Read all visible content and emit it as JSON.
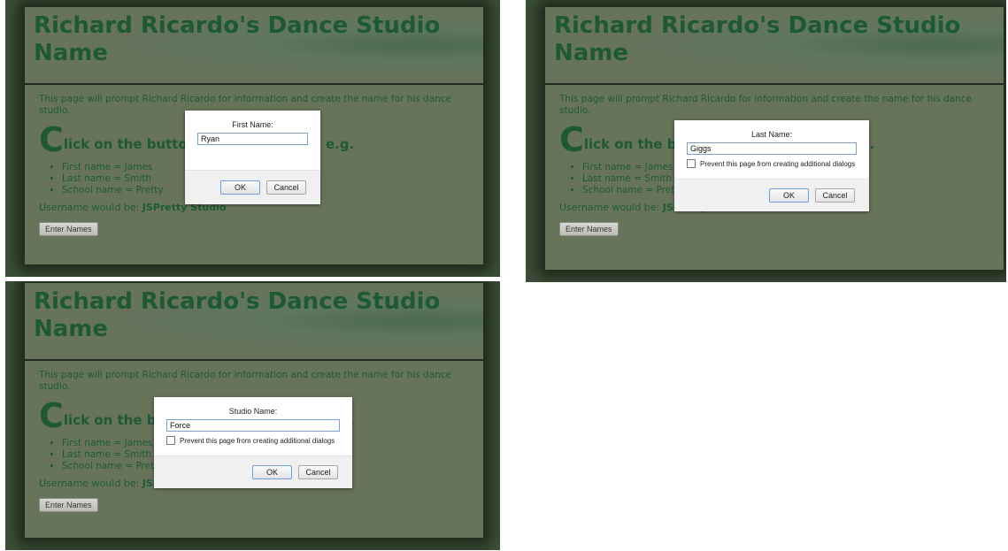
{
  "page": {
    "title": "Richard Ricardo's Dance Studio Name",
    "intro": "This page will prompt Richard Ricardo for information and create the name for his dance studio.",
    "instruction": {
      "initial": "C",
      "rest": "lick on the button to enter names: e.g."
    },
    "examples": [
      "First name = James",
      "Last name = Smith",
      "School name = Pretty"
    ],
    "username_label": "Username would be:",
    "username_value": "JSPretty Studio",
    "enter_button": "Enter Names"
  },
  "dialogs": [
    {
      "label": "First Name:",
      "value": "Ryan",
      "show_checkbox": false,
      "ok": "OK",
      "cancel": "Cancel"
    },
    {
      "label": "Last Name:",
      "value": "Giggs",
      "checkbox_label": "Prevent this page from creating additional dialogs",
      "show_checkbox": true,
      "ok": "OK",
      "cancel": "Cancel"
    },
    {
      "label": "Studio Name:",
      "value": "Force",
      "checkbox_label": "Prevent this page from creating additional dialogs",
      "show_checkbox": true,
      "ok": "OK",
      "cancel": "Cancel"
    }
  ],
  "colors": {
    "heading_green": "#1d5a34",
    "page_bg": "#68745a",
    "outer_bg": "#3c5038"
  }
}
